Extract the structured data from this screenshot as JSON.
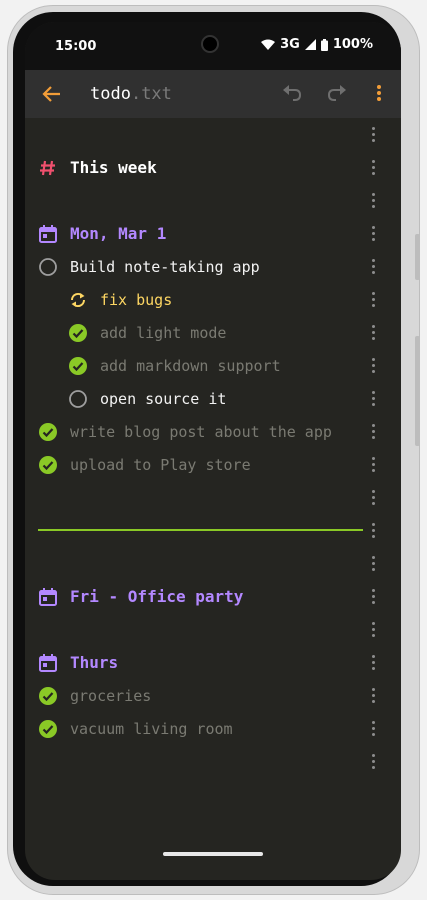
{
  "status_bar": {
    "time": "15:00",
    "network": "3G",
    "battery": "100%"
  },
  "app_bar": {
    "title": "todo",
    "extension": ".txt"
  },
  "lines": {
    "l1": "This week",
    "l3": "Mon, Mar 1",
    "l4": "Build note-taking app",
    "l5": "fix bugs",
    "l6": "add light mode",
    "l7": "add markdown support",
    "l8": "open source it",
    "l9": "write blog post about the app",
    "l10": "upload to Play store",
    "l14": "Fri - Office party",
    "l16": "Thurs",
    "l17": "groceries",
    "l18": "vacuum living room"
  },
  "colors": {
    "accent": "#f29d38",
    "heading_hash": "#f0506e",
    "day": "#b388ff",
    "done_check": "#8ac926",
    "in_progress": "#fdd663",
    "divider": "#8ac926"
  },
  "icons": {
    "back": "arrow-left-icon",
    "undo": "undo-icon",
    "redo": "redo-icon",
    "overflow": "more-vert-icon",
    "heading": "hash-icon",
    "day": "calendar-icon",
    "todo": "circle-outline-icon",
    "done": "check-circle-icon",
    "in_progress": "sync-icon",
    "line_menu": "drag-menu-icon"
  }
}
